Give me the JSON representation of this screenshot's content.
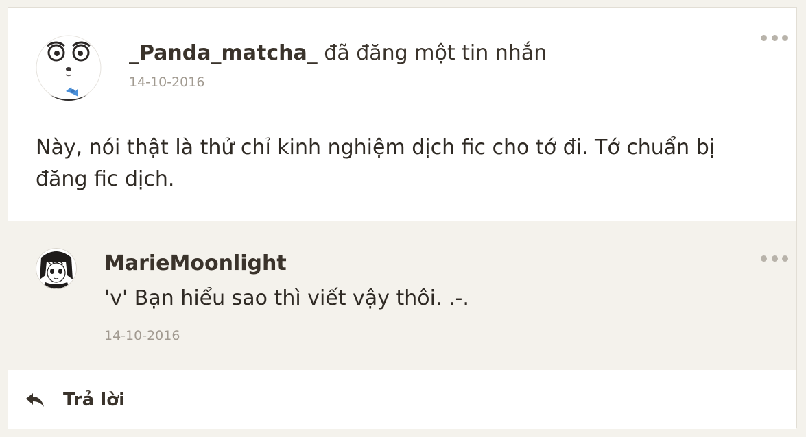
{
  "post": {
    "author": "_Panda_matcha_",
    "action": "đã đăng một tin nhắn",
    "date": "14-10-2016",
    "body": "Này, nói thật là thử chỉ kinh nghiệm dịch fic cho tớ đi. Tớ chuẩn bị đăng fic dịch.",
    "avatar_icon": "panda-avatar-icon"
  },
  "reply": {
    "author": "MarieMoonlight",
    "text": "'v' Bạn hiểu sao thì viết vậy thôi. .-.",
    "date": "14-10-2016",
    "avatar_icon": "manga-girl-avatar-icon"
  },
  "footer": {
    "reply_label": "Trả lời",
    "reply_icon": "reply-arrow-icon"
  },
  "colors": {
    "background": "#f4f2ec",
    "card": "#ffffff",
    "text": "#2f2a24",
    "muted": "#a19a90",
    "accent": "#4a90d9"
  }
}
